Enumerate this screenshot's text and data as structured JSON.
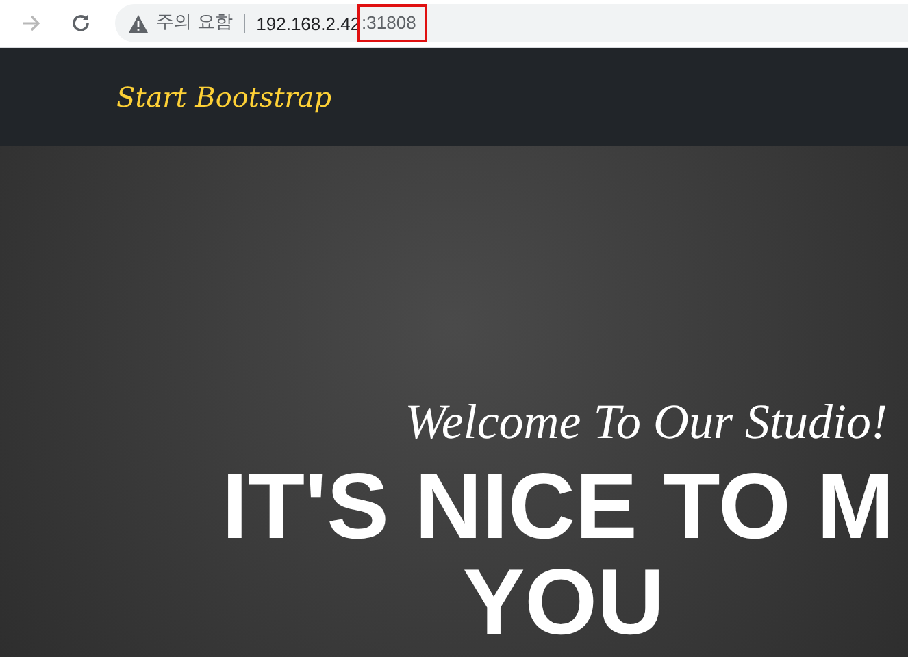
{
  "browser": {
    "forward_button": {
      "disabled": true
    },
    "security_label": "주의 요함",
    "address": {
      "host": "192.168.2.42",
      "port": ":31808",
      "port_highlighted": true
    }
  },
  "navbar": {
    "brand": "Start Bootstrap"
  },
  "hero": {
    "subheading": "Welcome To Our Studio!",
    "heading_lines": [
      "IT'S NICE TO M",
      "YOU"
    ]
  }
}
